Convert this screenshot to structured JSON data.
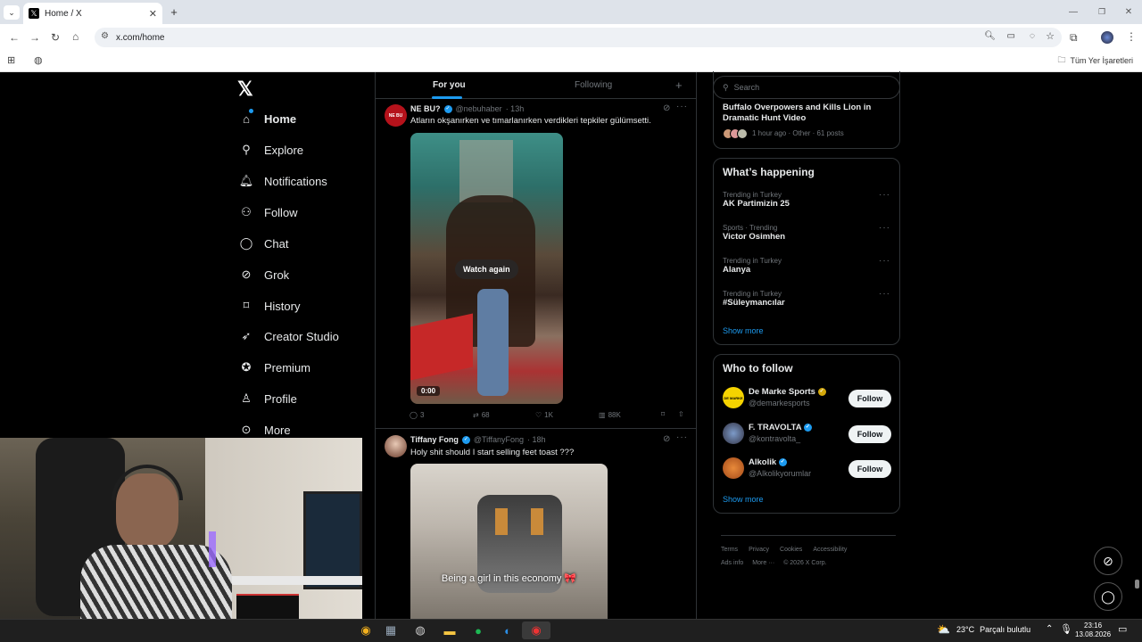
{
  "browser": {
    "tab_title": "Home / X",
    "url": "x.com/home",
    "bookmarks_all": "Tüm Yer İşaretleri"
  },
  "nav": {
    "items": [
      {
        "label": "Home",
        "icon": "home-icon"
      },
      {
        "label": "Explore",
        "icon": "search-icon"
      },
      {
        "label": "Notifications",
        "icon": "bell-icon"
      },
      {
        "label": "Follow",
        "icon": "person-plus-icon"
      },
      {
        "label": "Chat",
        "icon": "chat-icon"
      },
      {
        "label": "Grok",
        "icon": "grok-icon"
      },
      {
        "label": "History",
        "icon": "bookmark-icon"
      },
      {
        "label": "Creator Studio",
        "icon": "rocket-icon"
      },
      {
        "label": "Premium",
        "icon": "premium-icon"
      },
      {
        "label": "Profile",
        "icon": "person-icon"
      },
      {
        "label": "More",
        "icon": "more-icon"
      }
    ]
  },
  "feed": {
    "tabs": [
      "For you",
      "Following"
    ],
    "plus": "+",
    "posts": [
      {
        "name": "NE BU?",
        "avatar_text": "NE BU",
        "handle": "@nebuhaber",
        "time": "· 13h",
        "text": "Atların okşanırken ve tımarlanırken verdikleri tepkiler gülümsetti.",
        "media_overlay": "Watch again",
        "video_time": "0:00",
        "replies": "3",
        "reposts": "68",
        "likes": "1K",
        "views": "88K"
      },
      {
        "name": "Tiffany Fong",
        "handle": "@TiffanyFong",
        "time": "· 18h",
        "text": "Holy shit should I start selling feet toast ???",
        "media_caption": "Being a girl in this economy 🎀"
      }
    ]
  },
  "right": {
    "search_placeholder": "Search",
    "top_story": {
      "title": "Buffalo Overpowers and Kills Lion in Dramatic Hunt Video",
      "meta": "1 hour ago · Other · 61 posts"
    },
    "whats_happening": {
      "title": "What’s happening",
      "trends": [
        {
          "context": "Trending in Turkey",
          "name": "AK Partimizin 25"
        },
        {
          "context": "Sports · Trending",
          "name": "Victor Osimhen"
        },
        {
          "context": "Trending in Turkey",
          "name": "Alanya"
        },
        {
          "context": "Trending in Turkey",
          "name": "#Süleymancılar"
        }
      ],
      "show_more": "Show more"
    },
    "who_to_follow": {
      "title": "Who to follow",
      "accounts": [
        {
          "name": "De Marke Sports",
          "handle": "@demarkesports",
          "avatar_text": "DE MARKE",
          "badge": "gold"
        },
        {
          "name": "F. TRAVOLTA",
          "handle": "@kontravolta_",
          "avatar_text": "",
          "badge": "blue"
        },
        {
          "name": "Alkolik",
          "handle": "@Alkolikyorumlar",
          "avatar_text": "",
          "badge": "blue"
        }
      ],
      "follow_label": "Follow",
      "show_more": "Show more"
    },
    "footer": {
      "row1": [
        "Terms",
        "Privacy",
        "Cookies",
        "Accessibility"
      ],
      "row2": [
        "Ads info",
        "More ···",
        "© 2026 X Corp."
      ]
    }
  },
  "taskbar": {
    "weather_temp": "23°C",
    "weather_text": "Parçalı bulutlu",
    "time": "23:16",
    "date": "13.08.2026"
  }
}
